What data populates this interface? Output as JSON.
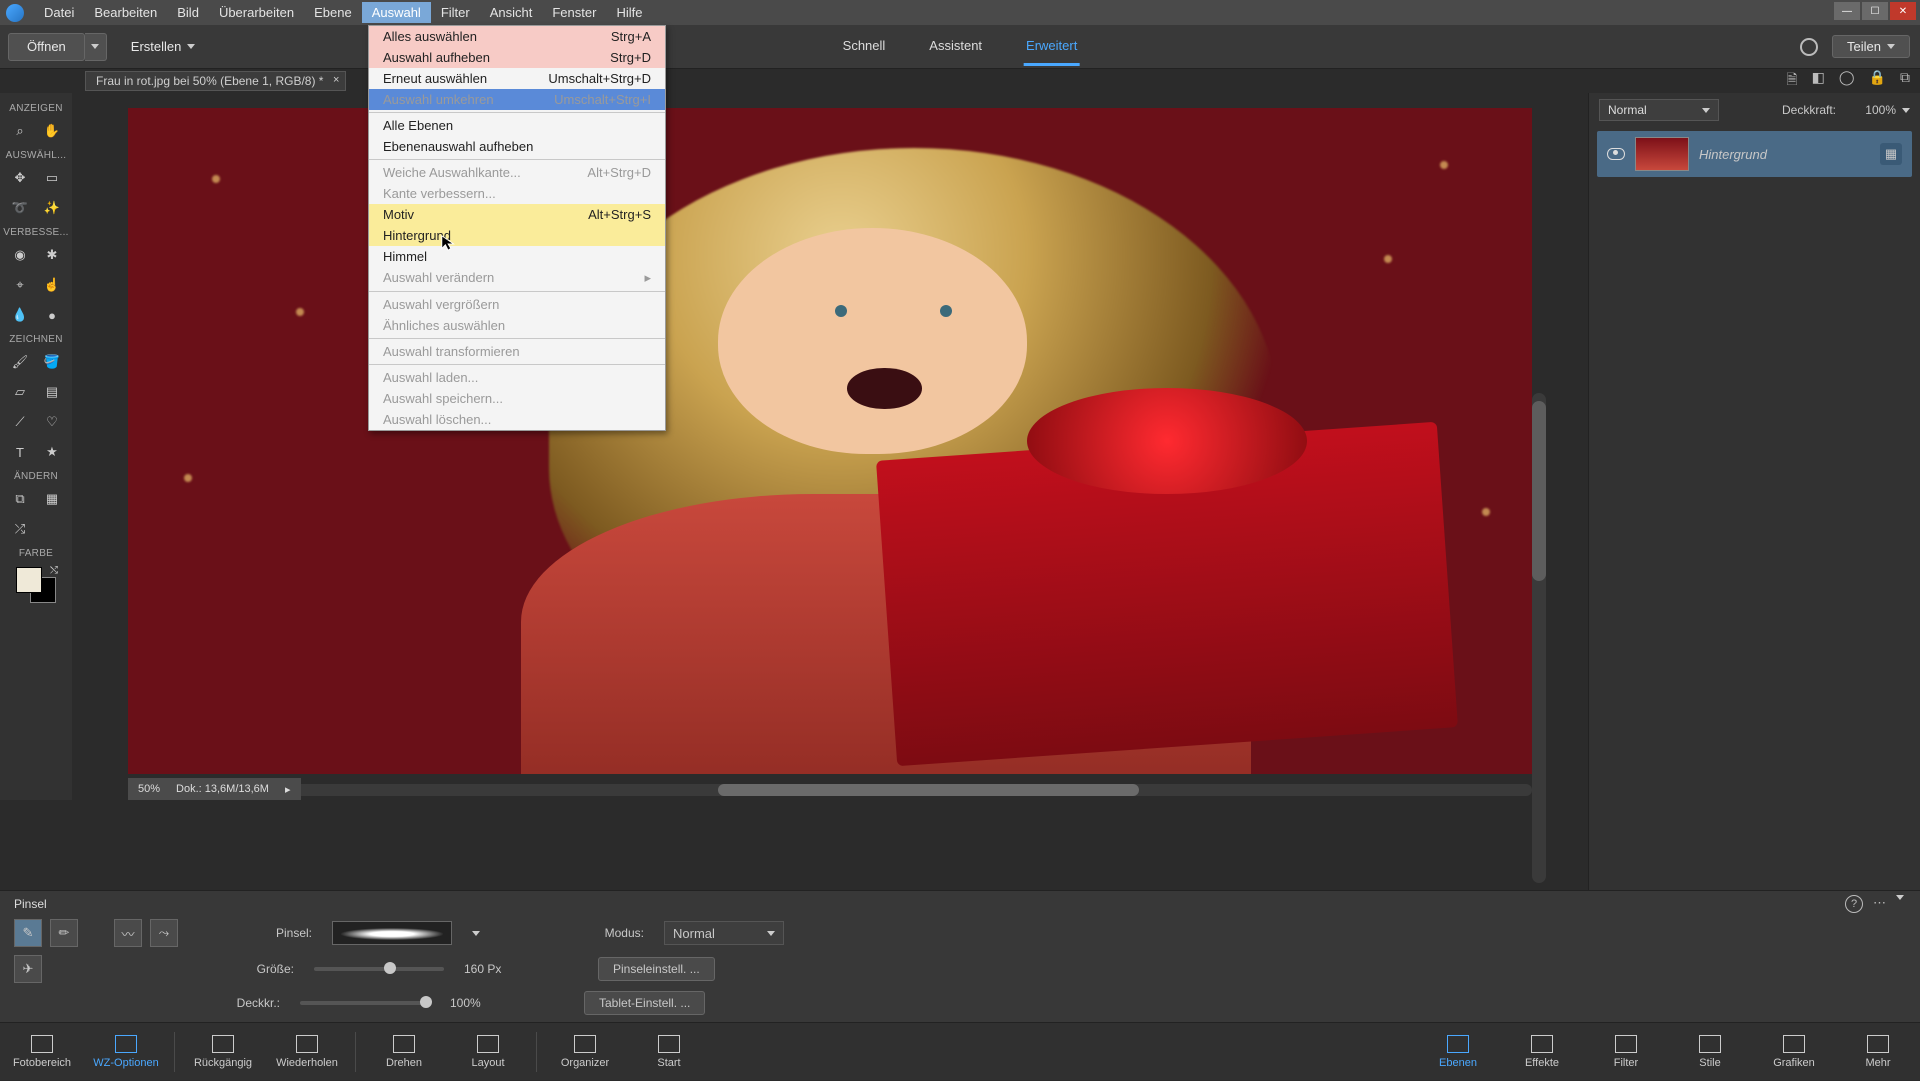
{
  "menubar": [
    "Datei",
    "Bearbeiten",
    "Bild",
    "Überarbeiten",
    "Ebene",
    "Auswahl",
    "Filter",
    "Ansicht",
    "Fenster",
    "Hilfe"
  ],
  "menubar_open_index": 5,
  "actionbar": {
    "open": "Öffnen",
    "create": "Erstellen",
    "share": "Teilen"
  },
  "modes": {
    "items": [
      "Schnell",
      "Assistent",
      "Erweitert"
    ],
    "active": 2
  },
  "doc_tab": {
    "label": "Frau in rot.jpg bei 50% (Ebene 1, RGB/8) *"
  },
  "dropdown": {
    "groups": [
      [
        {
          "label": "Alles auswählen",
          "shortcut": "Strg+A",
          "style": "red"
        },
        {
          "label": "Auswahl aufheben",
          "shortcut": "Strg+D",
          "style": "red"
        },
        {
          "label": "Erneut auswählen",
          "shortcut": "Umschalt+Strg+D"
        },
        {
          "label": "Auswahl umkehren",
          "shortcut": "Umschalt+Strg+I",
          "style": "blue",
          "disabled": true
        }
      ],
      [
        {
          "label": "Alle Ebenen"
        },
        {
          "label": "Ebenenauswahl aufheben"
        }
      ],
      [
        {
          "label": "Weiche Auswahlkante...",
          "shortcut": "Alt+Strg+D",
          "disabled": true
        },
        {
          "label": "Kante verbessern...",
          "disabled": true
        },
        {
          "label": "Motiv",
          "shortcut": "Alt+Strg+S",
          "style": "yellow"
        },
        {
          "label": "Hintergrund",
          "style": "yellow"
        },
        {
          "label": "Himmel"
        },
        {
          "label": "Auswahl verändern",
          "submenu": true,
          "disabled": true
        }
      ],
      [
        {
          "label": "Auswahl vergrößern",
          "disabled": true
        },
        {
          "label": "Ähnliches auswählen",
          "disabled": true
        }
      ],
      [
        {
          "label": "Auswahl transformieren",
          "disabled": true
        }
      ],
      [
        {
          "label": "Auswahl laden...",
          "disabled": true
        },
        {
          "label": "Auswahl speichern...",
          "disabled": true
        },
        {
          "label": "Auswahl löschen...",
          "disabled": true
        }
      ]
    ]
  },
  "toolbox": {
    "sections": [
      {
        "head": "ANZEIGEN",
        "rows": [
          [
            "zoom-icon",
            "hand-icon"
          ]
        ]
      },
      {
        "head": "AUSWÄHL...",
        "rows": [
          [
            "move-icon",
            "marquee-icon"
          ],
          [
            "lasso-icon",
            "wand-icon"
          ]
        ]
      },
      {
        "head": "VERBESSE...",
        "rows": [
          [
            "redeye-icon",
            "spot-icon"
          ],
          [
            "clone-icon",
            "smudge-icon"
          ],
          [
            "blur-icon",
            "sponge-icon"
          ]
        ]
      },
      {
        "head": "ZEICHNEN",
        "rows": [
          [
            "brush-icon",
            "bucket-icon"
          ],
          [
            "eraser-icon",
            "gradient-icon"
          ],
          [
            "eyedrop-icon",
            "shape-icon"
          ],
          [
            "type-icon",
            "custom-icon"
          ]
        ]
      },
      {
        "head": "ÄNDERN",
        "rows": [
          [
            "crop-icon",
            "recompose-icon"
          ],
          [
            "straighten-icon",
            ""
          ]
        ]
      },
      {
        "head": "FARBE",
        "rows": []
      }
    ]
  },
  "status": {
    "zoom": "50%",
    "doc": "Dok.: 13,6M/13,6M"
  },
  "layers": {
    "blend_label": "Normal",
    "opacity_label": "Deckkraft:",
    "opacity_value": "100%",
    "layer_name": "Hintergrund"
  },
  "options": {
    "title": "Pinsel",
    "brush_label": "Pinsel:",
    "mode_label": "Modus:",
    "mode_value": "Normal",
    "size_label": "Größe:",
    "size_value": "160 Px",
    "opacity_label": "Deckkr.:",
    "opacity_value": "100%",
    "btn_brush": "Pinseleinstell. ...",
    "btn_tablet": "Tablet-Einstell. ..."
  },
  "dock": {
    "left": [
      "Fotobereich",
      "WZ-Optionen",
      "Rückgängig",
      "Wiederholen",
      "Drehen",
      "Layout",
      "Organizer",
      "Start"
    ],
    "left_active": 1,
    "right": [
      "Ebenen",
      "Effekte",
      "Filter",
      "Stile",
      "Grafiken",
      "Mehr"
    ],
    "right_active": 0
  }
}
